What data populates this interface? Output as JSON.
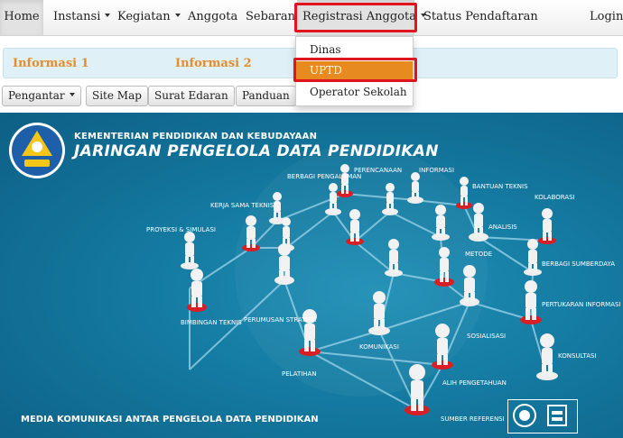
{
  "navbar": {
    "items": [
      {
        "label": "Home"
      },
      {
        "label": "Instansi"
      },
      {
        "label": "Kegiatan"
      },
      {
        "label": "Anggota"
      },
      {
        "label": "Sebaran"
      },
      {
        "label": "Registrasi Anggota"
      },
      {
        "label": "Status Pendaftaran"
      }
    ],
    "login": "Login"
  },
  "dropdown": {
    "items": [
      {
        "label": "Dinas"
      },
      {
        "label": "UPTD",
        "selected": true
      },
      {
        "label": "Operator Sekolah"
      }
    ]
  },
  "info_bar": {
    "link1": "Informasi 1",
    "link2": "Informasi 2"
  },
  "buttons": {
    "pengantar": "Pengantar",
    "sitemap": "Site Map",
    "surat_edaran": "Surat Edaran",
    "panduan": "Panduan"
  },
  "banner": {
    "line1": "KEMENTERIAN PENDIDIKAN DAN KEBUDAYAAN",
    "line2": "JARINGAN PENGELOLA DATA PENDIDIKAN",
    "footer": "MEDIA KOMUNIKASI ANTAR PENGELOLA DATA PENDIDIKAN",
    "nodes": [
      {
        "label": "PERENCANAAN"
      },
      {
        "label": "INFORMASI"
      },
      {
        "label": "BERBAGI PENGALAMAN"
      },
      {
        "label": "BANTUAN TEKNIS"
      },
      {
        "label": "KOLABORASI"
      },
      {
        "label": "KERJA SAMA TEKNIS"
      },
      {
        "label": "ANALISIS"
      },
      {
        "label": "PROYEKSI & SIMULASI"
      },
      {
        "label": "METODE"
      },
      {
        "label": "BERBAGI SUMBERDAYA"
      },
      {
        "label": "PERTUKARAN INFORMASI"
      },
      {
        "label": "BIMBINGAN TEKNIS"
      },
      {
        "label": "PERUMUSAN STRATEGI"
      },
      {
        "label": "KOMUNIKASI"
      },
      {
        "label": "SOSIALISASI"
      },
      {
        "label": "KONSULTASI"
      },
      {
        "label": "PELATIHAN"
      },
      {
        "label": "ALIH PENGETAHUAN"
      },
      {
        "label": "SUMBER REFERENSI"
      }
    ]
  },
  "colors": {
    "accent": "#e78a20",
    "highlight": "#e0141f",
    "banner": "#1479a0"
  }
}
